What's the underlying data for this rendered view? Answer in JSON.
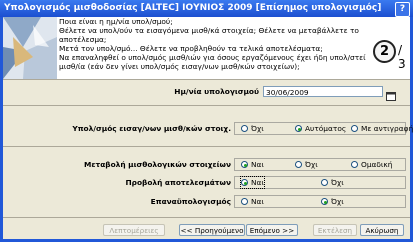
{
  "window": {
    "title": "Υπολογισμός μισθοδοσίας [ALTEC]  ΙΟΥΝΙΟΣ 2009  [Επίσημος υπολογισμός]",
    "help_label": "?"
  },
  "header": {
    "questions": [
      "Ποια είναι η ημ/νία υπολ/σμού;",
      "Θέλετε να υπολ/ούν τα εισαγόμενα μισθ/κά στοιχεία; Θέλετε να μεταβάλλετε το αποτέλεσμα;",
      "Μετά τον υπολ/σμό... Θέλετε να προβληθούν τα τελικά αποτελέσματα;",
      "Να επαναληφθεί ο υπολ/σμός μισθ/ιών για όσους εργαζόμενους έχει ήδη υπολ/στεί μισθ/ία (εάν δεν γίνει υπολ/σμός εισαγ/νων μισθ/κών στοιχείων);"
    ],
    "step_current": "2",
    "step_total": "/ 3"
  },
  "form": {
    "date_label": "Ημ/νία υπολογισμού",
    "date_value": "30/06/2009",
    "calc_label": "Υπολ/σμός εισαγ/νων μισθ/κών στοιχ.",
    "calc_options": [
      "Όχι",
      "Αυτόματος",
      "Με αντιγραφή"
    ],
    "calc_selected": 1,
    "modify_label": "Μεταβολή μισθολογικών στοιχείων",
    "modify_options": [
      "Ναι",
      "Όχι",
      "Ομαδική"
    ],
    "modify_selected": 0,
    "display_label": "Προβολή αποτελεσμάτων",
    "display_options": [
      "Ναι",
      "Όχι"
    ],
    "display_selected": 0,
    "recalc_label": "Επαναϋπολογισμός",
    "recalc_options": [
      "Ναι",
      "Όχι"
    ],
    "recalc_selected": 1
  },
  "buttons": {
    "details": "Λεπτομέρειες",
    "previous": "<< Προηγούμενο",
    "next": "Επόμενο >>",
    "execute": "Εκτέλεση",
    "cancel": "Ακύρωση"
  }
}
